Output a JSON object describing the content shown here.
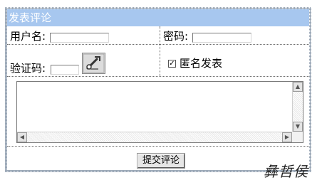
{
  "form": {
    "title": "发表评论",
    "username_label": "用户名:",
    "username_value": "",
    "password_label": "密码:",
    "password_value": "",
    "captcha_label": "验证码:",
    "captcha_value": "",
    "anonymous_checked": true,
    "anonymous_label": "匿名发表",
    "comment_value": "",
    "submit_label": "提交评论"
  },
  "watermark": "彝哲侯",
  "colors": {
    "title_bg": "#a7c7ef",
    "title_text": "#ffffff"
  }
}
